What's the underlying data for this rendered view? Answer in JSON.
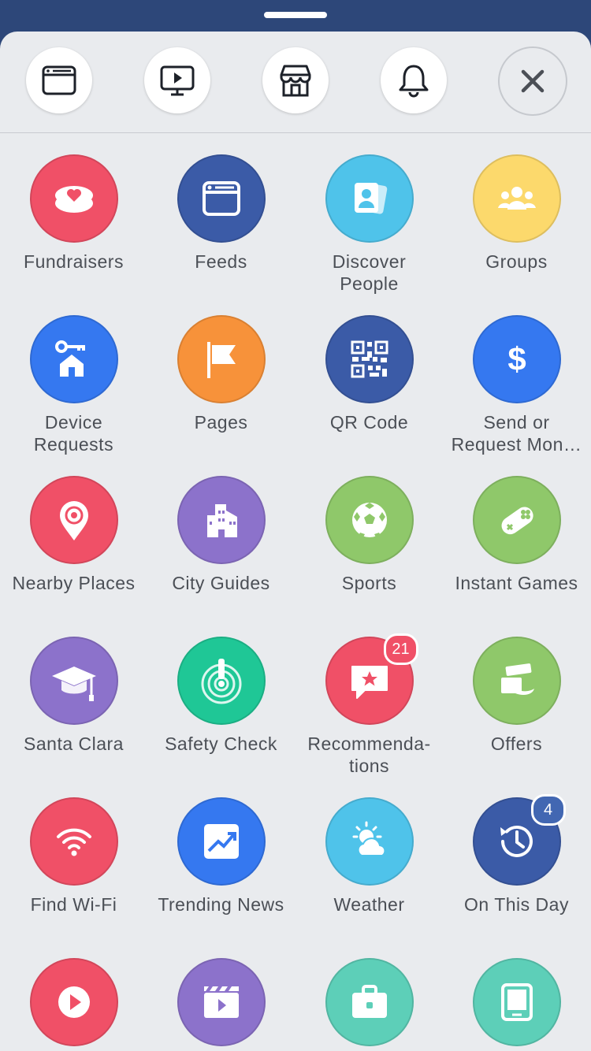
{
  "colors": {
    "header_bg": "#2d4779",
    "sheet_bg": "#e9ebee",
    "label": "#4b4f56",
    "badge_red": "#f05067",
    "badge_blue": "#4267b2"
  },
  "toolbar": [
    {
      "name": "news-feed-shortcut",
      "icon": "news-feed-icon"
    },
    {
      "name": "watch-shortcut",
      "icon": "video-monitor-icon"
    },
    {
      "name": "marketplace-shortcut",
      "icon": "storefront-icon"
    },
    {
      "name": "notifications-shortcut",
      "icon": "bell-icon"
    },
    {
      "name": "close-button",
      "icon": "close-icon"
    }
  ],
  "tiles": [
    {
      "label": "Fundraisers",
      "icon": "fundraiser-heart-icon",
      "color": "#f05067"
    },
    {
      "label": "Feeds",
      "icon": "feed-window-icon",
      "color": "#3b5ba7"
    },
    {
      "label": "Discover\nPeople",
      "icon": "people-cards-icon",
      "color": "#4fc3ea"
    },
    {
      "label": "Groups",
      "icon": "group-people-icon",
      "color": "#fcd96c"
    },
    {
      "label": "Device\nRequests",
      "icon": "key-house-icon",
      "color": "#3578f0"
    },
    {
      "label": "Pages",
      "icon": "flag-icon",
      "color": "#f7923a"
    },
    {
      "label": "QR Code",
      "icon": "qr-code-icon",
      "color": "#3b5ba7"
    },
    {
      "label": "Send or\nRequest Mon…",
      "icon": "dollar-icon",
      "color": "#3578f0"
    },
    {
      "label": "Nearby Places",
      "icon": "location-pin-icon",
      "color": "#f05067"
    },
    {
      "label": "City Guides",
      "icon": "city-buildings-icon",
      "color": "#8c72cb"
    },
    {
      "label": "Sports",
      "icon": "soccer-ball-icon",
      "color": "#8fc86a"
    },
    {
      "label": "Instant Games",
      "icon": "game-controller-icon",
      "color": "#8fc86a"
    },
    {
      "label": "Santa Clara",
      "icon": "graduation-cap-icon",
      "color": "#8c72cb"
    },
    {
      "label": "Safety Check",
      "icon": "safety-alert-icon",
      "color": "#1fc796"
    },
    {
      "label": "Recommenda-\ntions",
      "icon": "star-chat-icon",
      "color": "#f05067",
      "badge": "21",
      "badge_color": "#f05067"
    },
    {
      "label": "Offers",
      "icon": "offer-tag-icon",
      "color": "#8fc86a"
    },
    {
      "label": "Find Wi-Fi",
      "icon": "wifi-icon",
      "color": "#f05067"
    },
    {
      "label": "Trending News",
      "icon": "trending-chart-icon",
      "color": "#3578f0"
    },
    {
      "label": "Weather",
      "icon": "sun-cloud-icon",
      "color": "#4fc3ea"
    },
    {
      "label": "On This Day",
      "icon": "clock-history-icon",
      "color": "#3b5ba7",
      "badge": "4",
      "badge_color": "#4267b2"
    },
    {
      "label": "",
      "icon": "play-video-icon",
      "color": "#f05067"
    },
    {
      "label": "",
      "icon": "movie-clapper-icon",
      "color": "#8c72cb"
    },
    {
      "label": "",
      "icon": "briefcase-icon",
      "color": "#5dcfb8"
    },
    {
      "label": "",
      "icon": "tablet-icon",
      "color": "#5dcfb8"
    }
  ]
}
